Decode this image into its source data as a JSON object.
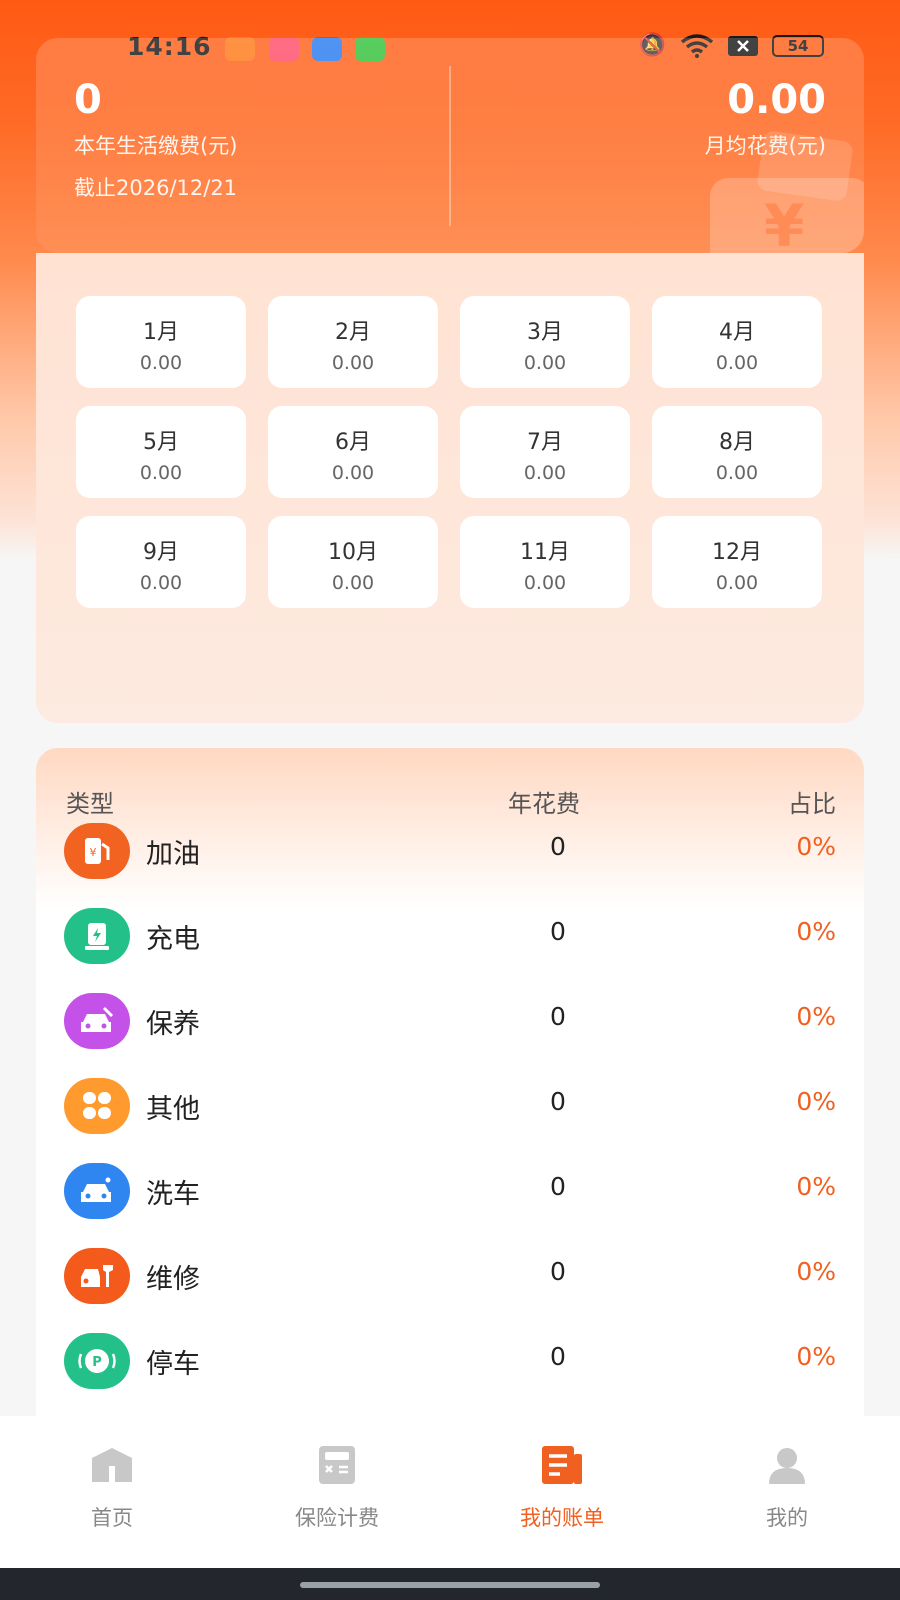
{
  "status_bar": {
    "time": "14:16",
    "battery": "54"
  },
  "summary": {
    "year_fee_value": "0",
    "year_fee_label": "本年生活缴费(元)",
    "as_of": "截止2026/12/21",
    "monthly_avg_value": "0.00",
    "monthly_avg_label": "月均花费(元)",
    "wallet_symbol": "¥"
  },
  "months": [
    {
      "name": "1月",
      "value": "0.00"
    },
    {
      "name": "2月",
      "value": "0.00"
    },
    {
      "name": "3月",
      "value": "0.00"
    },
    {
      "name": "4月",
      "value": "0.00"
    },
    {
      "name": "5月",
      "value": "0.00"
    },
    {
      "name": "6月",
      "value": "0.00"
    },
    {
      "name": "7月",
      "value": "0.00"
    },
    {
      "name": "8月",
      "value": "0.00"
    },
    {
      "name": "9月",
      "value": "0.00"
    },
    {
      "name": "10月",
      "value": "0.00"
    },
    {
      "name": "11月",
      "value": "0.00"
    },
    {
      "name": "12月",
      "value": "0.00"
    }
  ],
  "categories_table": {
    "headers": {
      "type": "类型",
      "amount": "年花费",
      "percent": "占比"
    },
    "rows": [
      {
        "name": "加油",
        "amount": "0",
        "percent": "0%",
        "icon": "fuel-icon",
        "color": "#f26322"
      },
      {
        "name": "充电",
        "amount": "0",
        "percent": "0%",
        "icon": "charging-icon",
        "color": "#23c08a"
      },
      {
        "name": "保养",
        "amount": "0",
        "percent": "0%",
        "icon": "maintenance-icon",
        "color": "#c552e8"
      },
      {
        "name": "其他",
        "amount": "0",
        "percent": "0%",
        "icon": "other-icon",
        "color": "#ff9a2e"
      },
      {
        "name": "洗车",
        "amount": "0",
        "percent": "0%",
        "icon": "car-wash-icon",
        "color": "#2f86f0"
      },
      {
        "name": "维修",
        "amount": "0",
        "percent": "0%",
        "icon": "repair-icon",
        "color": "#f35a1c"
      },
      {
        "name": "停车",
        "amount": "0",
        "percent": "0%",
        "icon": "parking-icon",
        "color": "#23c08a"
      }
    ]
  },
  "bottom_nav": {
    "items": [
      {
        "label": "首页",
        "icon": "home-icon",
        "active": false
      },
      {
        "label": "保险计费",
        "icon": "calculator-icon",
        "active": false
      },
      {
        "label": "我的账单",
        "icon": "bill-icon",
        "active": true
      },
      {
        "label": "我的",
        "icon": "user-icon",
        "active": false
      }
    ]
  },
  "colors": {
    "accent": "#f06020",
    "header_orange": "#ff5a14",
    "inactive_nav": "#888888"
  }
}
